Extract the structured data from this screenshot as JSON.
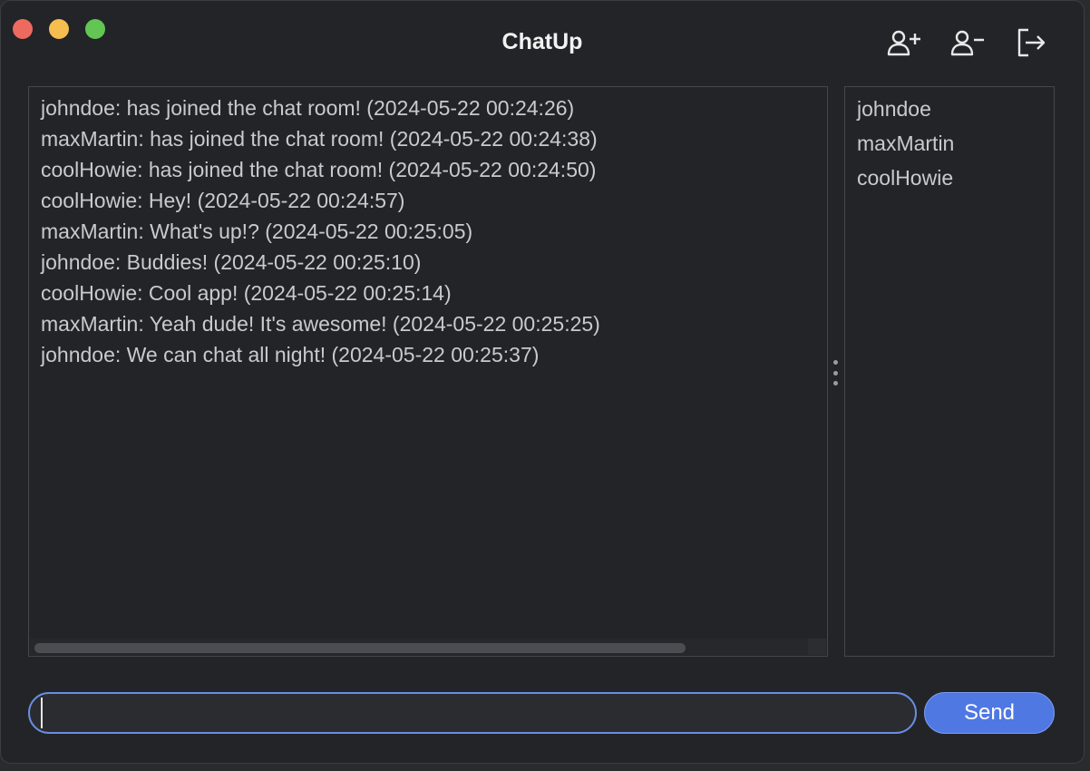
{
  "window": {
    "title": "ChatUp",
    "controls": [
      "close",
      "minimize",
      "maximize"
    ]
  },
  "toolbar": [
    {
      "icon": "add-user-icon"
    },
    {
      "icon": "remove-user-icon"
    },
    {
      "icon": "logout-icon"
    }
  ],
  "messages": [
    "johndoe: has joined the chat room! (2024-05-22 00:24:26)",
    "maxMartin: has joined the chat room! (2024-05-22 00:24:38)",
    "coolHowie: has joined the chat room! (2024-05-22 00:24:50)",
    "coolHowie: Hey! (2024-05-22 00:24:57)",
    "maxMartin: What's up!? (2024-05-22 00:25:05)",
    "johndoe: Buddies! (2024-05-22 00:25:10)",
    "coolHowie: Cool app! (2024-05-22 00:25:14)",
    "maxMartin: Yeah dude! It's awesome! (2024-05-22 00:25:25)",
    "johndoe: We can chat all night! (2024-05-22 00:25:37)"
  ],
  "users": [
    "johndoe",
    "maxMartin",
    "coolHowie"
  ],
  "composer": {
    "value": "",
    "send_label": "Send"
  },
  "colors": {
    "background": "#222427",
    "accent": "#4f78e3",
    "input_border": "#6a8de0",
    "text": "#c9cacc"
  }
}
